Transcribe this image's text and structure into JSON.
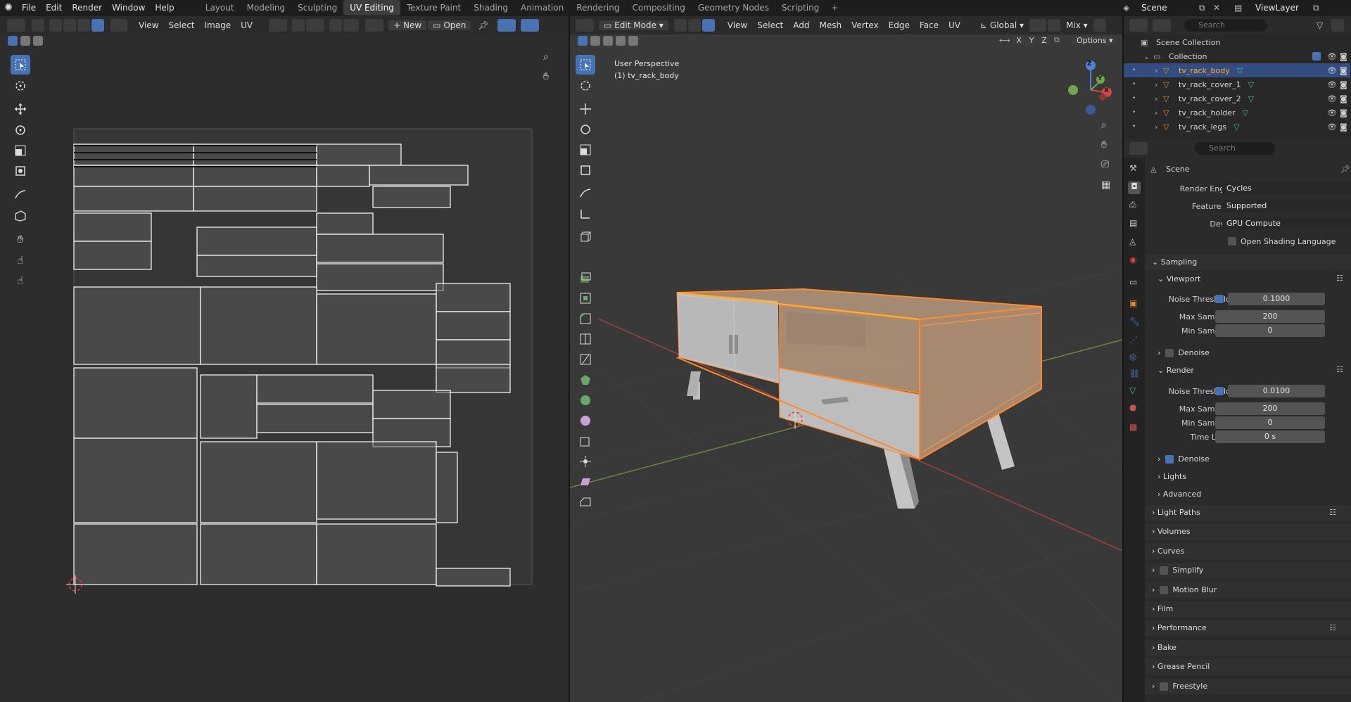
{
  "menu": [
    "File",
    "Edit",
    "Render",
    "Window",
    "Help"
  ],
  "workspaces": [
    "Layout",
    "Modeling",
    "Sculpting",
    "UV Editing",
    "Texture Paint",
    "Shading",
    "Animation",
    "Rendering",
    "Compositing",
    "Geometry Nodes",
    "Scripting"
  ],
  "scene_name": "Scene",
  "view_layer": "ViewLayer",
  "uv_header": {
    "view": "View",
    "select": "Select",
    "image": "Image",
    "uv": "UV",
    "new": "New",
    "open": "Open"
  },
  "viewport_header": {
    "mode": "Edit Mode",
    "view": "View",
    "select": "Select",
    "add": "Add",
    "mesh": "Mesh",
    "vertex": "Vertex",
    "edge": "Edge",
    "face": "Face",
    "uv": "UV",
    "orientation": "Global",
    "pivot": "Mix",
    "options": "Options",
    "axis_x": "X",
    "axis_y": "Y",
    "axis_z": "Z"
  },
  "viewport_info": {
    "perspective": "User Perspective",
    "object": "(1) tv_rack_body"
  },
  "gizmo": {
    "x": "X",
    "y": "Y",
    "z": "Z"
  },
  "outliner": {
    "search": "Search",
    "root": "Scene Collection",
    "collection": "Collection",
    "objects": [
      "tv_rack_body",
      "tv_rack_cover_1",
      "tv_rack_cover_2",
      "tv_rack_holder",
      "tv_rack_legs"
    ]
  },
  "properties": {
    "search": "Search",
    "scene": "Scene",
    "render_engine_label": "Render Engine",
    "render_engine": "Cycles",
    "feature_set_label": "Feature Set",
    "feature_set": "Supported",
    "device_label": "Device",
    "device": "GPU Compute",
    "osl_label": "Open Shading Language",
    "sampling": "Sampling",
    "viewport": "Viewport",
    "noise_threshold_label": "Noise Threshold",
    "vp_noise": "0.1000",
    "max_samples_label": "Max Samples",
    "vp_max": "200",
    "min_samples_label": "Min Samples",
    "vp_min": "0",
    "denoise": "Denoise",
    "render": "Render",
    "r_noise": "0.0100",
    "r_max": "200",
    "r_min": "0",
    "time_limit_label": "Time Limit",
    "time_limit": "0 s",
    "lights": "Lights",
    "advanced": "Advanced",
    "panels": [
      "Light Paths",
      "Volumes",
      "Curves",
      "Simplify",
      "Motion Blur",
      "Film",
      "Performance",
      "Bake",
      "Grease Pencil",
      "Freestyle"
    ]
  },
  "colors": {
    "accent": "#4772b3",
    "selection": "#ff8a2a",
    "active_item": "#ffaf29"
  }
}
